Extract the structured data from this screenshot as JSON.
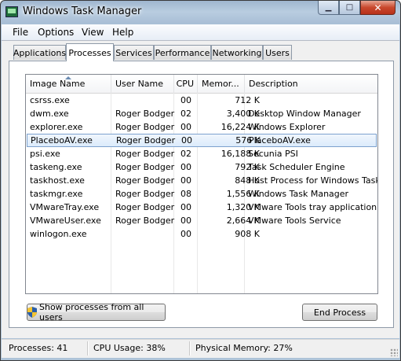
{
  "window": {
    "title": "Windows Task Manager"
  },
  "menu": [
    "File",
    "Options",
    "View",
    "Help"
  ],
  "tabs": [
    "Applications",
    "Processes",
    "Services",
    "Performance",
    "Networking",
    "Users"
  ],
  "columns": {
    "name": "Image Name",
    "user": "User Name",
    "cpu": "CPU",
    "mem": "Memor...",
    "desc": "Description"
  },
  "processes": [
    {
      "name": "csrss.exe",
      "user": "",
      "cpu": "00",
      "mem": "712 K",
      "desc": ""
    },
    {
      "name": "dwm.exe",
      "user": "Roger Bodger",
      "cpu": "02",
      "mem": "3,400 K",
      "desc": "Desktop Window Manager"
    },
    {
      "name": "explorer.exe",
      "user": "Roger Bodger",
      "cpu": "00",
      "mem": "16,224 K",
      "desc": "Windows Explorer"
    },
    {
      "name": "PlaceboAV.exe",
      "user": "Roger Bodger",
      "cpu": "00",
      "mem": "576 K",
      "desc": "PlaceboAV.exe",
      "selected": true
    },
    {
      "name": "psi.exe",
      "user": "Roger Bodger",
      "cpu": "02",
      "mem": "16,188 K",
      "desc": "Secunia PSI"
    },
    {
      "name": "taskeng.exe",
      "user": "Roger Bodger",
      "cpu": "00",
      "mem": "792 K",
      "desc": "Task Scheduler Engine"
    },
    {
      "name": "taskhost.exe",
      "user": "Roger Bodger",
      "cpu": "00",
      "mem": "848 K",
      "desc": "Host Process for Windows Tasks"
    },
    {
      "name": "taskmgr.exe",
      "user": "Roger Bodger",
      "cpu": "08",
      "mem": "1,556 K",
      "desc": "Windows Task Manager"
    },
    {
      "name": "VMwareTray.exe",
      "user": "Roger Bodger",
      "cpu": "00",
      "mem": "1,320 K",
      "desc": "VMware Tools tray application"
    },
    {
      "name": "VMwareUser.exe",
      "user": "Roger Bodger",
      "cpu": "00",
      "mem": "2,664 K",
      "desc": "VMware Tools Service"
    },
    {
      "name": "winlogon.exe",
      "user": "",
      "cpu": "00",
      "mem": "908 K",
      "desc": ""
    }
  ],
  "buttons": {
    "show_all": "Show processes from all users",
    "end_process": "End Process"
  },
  "status": {
    "processes": "Processes: 41",
    "cpu": "CPU Usage: 38%",
    "memory": "Physical Memory: 27%"
  }
}
